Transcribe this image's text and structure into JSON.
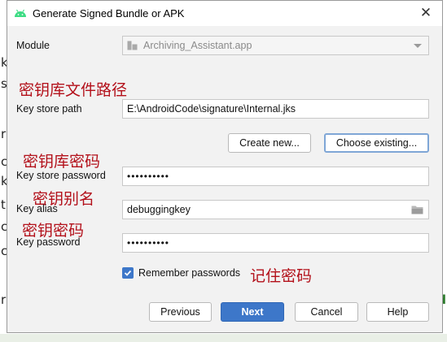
{
  "background": {
    "left_letters": [
      "k",
      "s",
      "r",
      "c",
      "k",
      "t",
      "c",
      "c",
      "r"
    ],
    "right_letter": "d"
  },
  "dialog": {
    "title": "Generate Signed Bundle or APK",
    "close_symbol": "✕"
  },
  "module": {
    "label": "Module",
    "value": "Archiving_Assistant.app"
  },
  "key_store_path": {
    "annotation": "密钥库文件路径",
    "label": "Key store path",
    "value": "E:\\AndroidCode\\signature\\Internal.jks",
    "create_new_label": "Create new...",
    "choose_existing_label": "Choose existing..."
  },
  "key_store_password": {
    "annotation": "密钥库密码",
    "label": "Key store password",
    "value": "••••••••••"
  },
  "key_alias": {
    "annotation": "密钥别名",
    "label": "Key alias",
    "value": "debuggingkey"
  },
  "key_password": {
    "annotation": "密钥密码",
    "label": "Key password",
    "value": "••••••••••"
  },
  "remember": {
    "label": "Remember passwords",
    "checked": true,
    "annotation": "记住密码"
  },
  "footer": {
    "previous_label": "Previous",
    "next_label": "Next",
    "cancel_label": "Cancel",
    "help_label": "Help"
  },
  "colors": {
    "accent": "#3d77c9",
    "annotation": "#b3101a",
    "android_green": "#3ddc84"
  }
}
